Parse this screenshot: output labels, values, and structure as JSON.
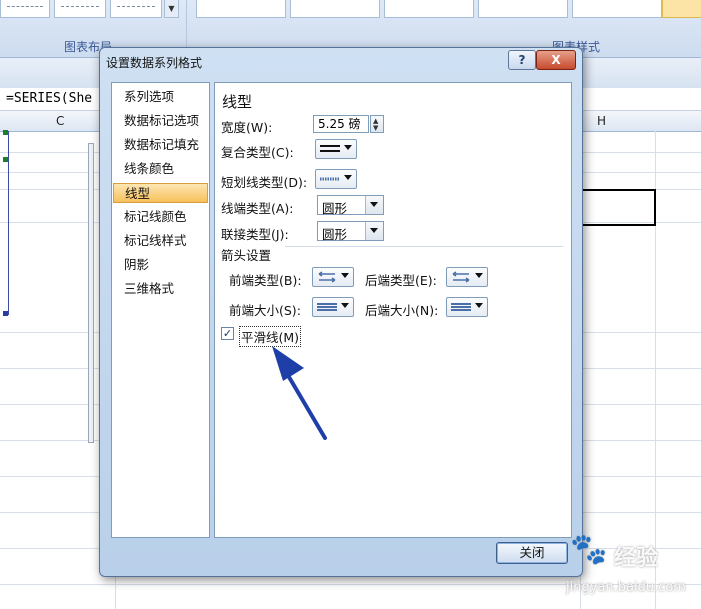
{
  "excel": {
    "ribbon_groups": [
      "图表布局",
      "图表样式"
    ],
    "formula": "=SERIES(She",
    "columns": [
      "C",
      "H"
    ]
  },
  "dialog": {
    "title": "设置数据系列格式",
    "help_label": "?",
    "close_x_label": "X",
    "nav": [
      "系列选项",
      "数据标记选项",
      "数据标记填充",
      "线条颜色",
      "线型",
      "标记线颜色",
      "标记线样式",
      "阴影",
      "三维格式"
    ],
    "active_nav": "线型",
    "section_title": "线型",
    "width": {
      "label": "宽度(W):",
      "value": "5.25 磅"
    },
    "compound_type": {
      "label": "复合类型(C):"
    },
    "dash_type": {
      "label": "短划线类型(D):"
    },
    "cap_type": {
      "label": "线端类型(A):",
      "value": "圆形"
    },
    "join_type": {
      "label": "联接类型(J):",
      "value": "圆形"
    },
    "arrow_settings": {
      "heading": "箭头设置",
      "begin_type": "前端类型(B):",
      "end_type": "后端类型(E):",
      "begin_size": "前端大小(S):",
      "end_size": "后端大小(N):"
    },
    "smooth_line": {
      "label": "平滑线(M)",
      "checked": true,
      "check_glyph": "✓"
    },
    "close_button": "关闭"
  },
  "watermark": {
    "text": "经验",
    "url": "jingyan.baidu.com",
    "paw": "🐾"
  },
  "colors": {
    "annotation_arrow": "#1f3fa8",
    "active_nav": "#f7c05c"
  }
}
